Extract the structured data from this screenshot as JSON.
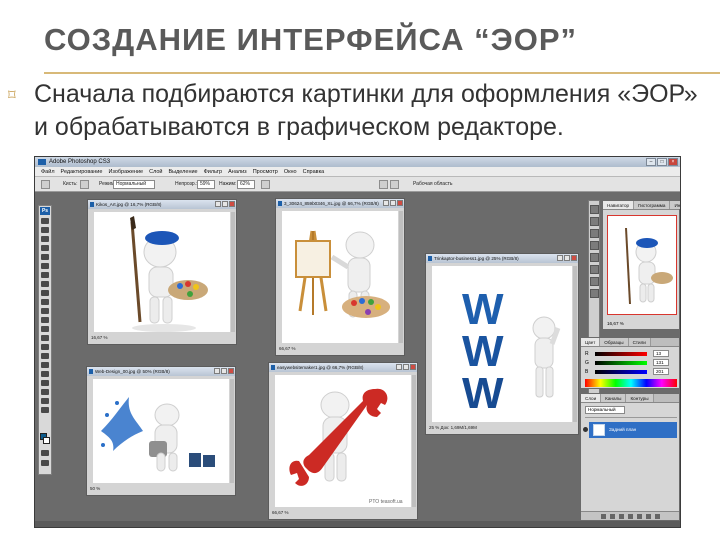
{
  "slide": {
    "title": "СОЗДАНИЕ ИНТЕРФЕЙСА “ЭОР”",
    "bullet": "Сначала подбираются картинки для оформления «ЭОР» и обрабатываются в графическом редакторе."
  },
  "photoshop": {
    "window_title": "Adobe Photoshop CS3",
    "menu": [
      "Файл",
      "Редактирование",
      "Изображение",
      "Слой",
      "Выделение",
      "Фильтр",
      "Анализ",
      "Просмотр",
      "Окно",
      "Справка"
    ],
    "toolbox_logo": "Ps",
    "options_bar": {
      "brush_label": "Кисть:",
      "mode_label": "Режим:",
      "mode_value": "Нормальный",
      "opacity_label": "Непрозр.:",
      "opacity_value": "59%",
      "flow_label": "Нажим:",
      "flow_value": "62%",
      "workspace": "Рабочая область"
    },
    "documents": [
      {
        "title": "Kikos_Art.jpg @ 16,7% (RGB/8)",
        "status": "16,67 %"
      },
      {
        "title": "3_30624_859b0346_XL.jpg @ 66,7% (RGB/8)",
        "status": "66,67 %"
      },
      {
        "title": "Trinkaptor-business1.jpg @ 25% (RGB/8)",
        "status": "25 %",
        "docsize": "Док: 1,69M/1,69M"
      },
      {
        "title": "Web-Design_00.jpg @ 50% (RGB/8)",
        "status": "50 %"
      },
      {
        "title": "easywebsitemaker1.jpg @ 66,7% (RGB/8)",
        "status": "66,67 %",
        "watermark": "PTO teasoft.ua"
      }
    ],
    "navigator_tabs": [
      "Навигатор",
      "Гистограмма",
      "Инфо"
    ],
    "navigator_zoom": "16,67 %",
    "color_tabs": [
      "Цвет",
      "Образцы",
      "Стили"
    ],
    "color_channels": [
      {
        "label": "R",
        "value": "13"
      },
      {
        "label": "G",
        "value": "131"
      },
      {
        "label": "B",
        "value": "201"
      }
    ],
    "layers_tabs": [
      "Слои",
      "Каналы",
      "Контуры"
    ],
    "layers_blend": "Нормальный",
    "layer_name": "Задний план",
    "colors": {
      "foreground": "#0D83C9",
      "background": "#FFFFFF",
      "workspace": "#6B6B6B",
      "www_blue": "#1e5fae",
      "wrench_red": "#cc2a24",
      "beret_blue": "#1c56b8"
    }
  }
}
